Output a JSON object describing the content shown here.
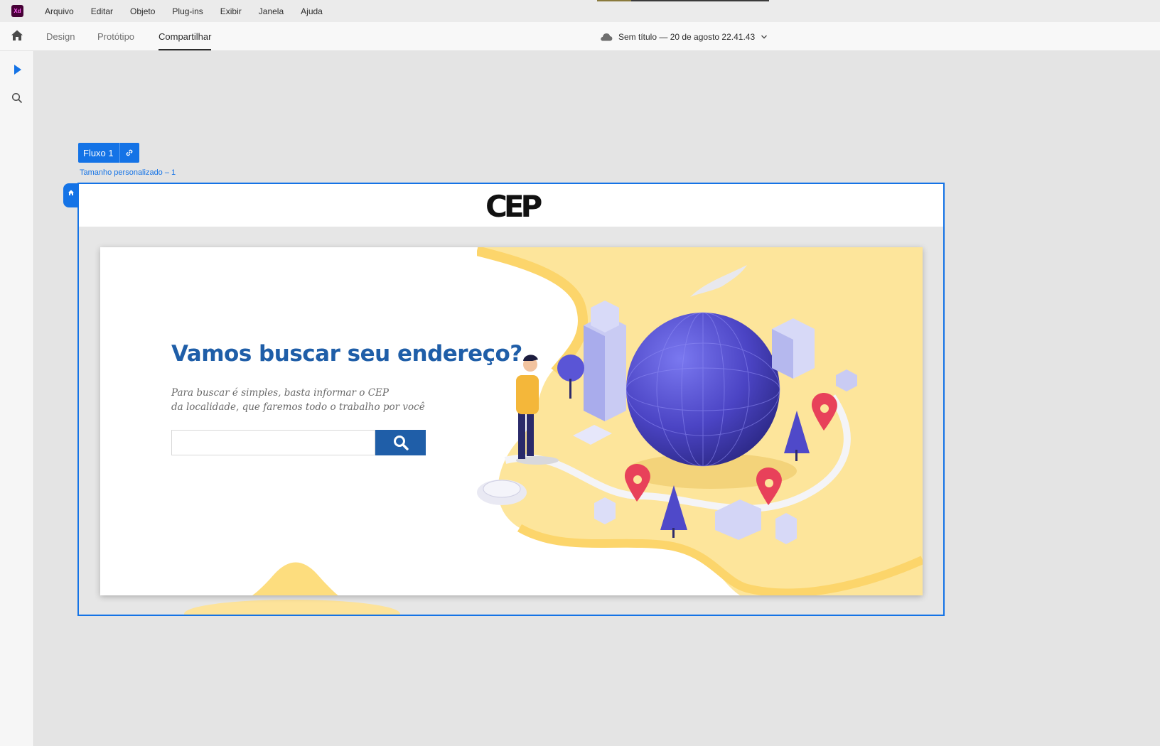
{
  "app": {
    "icon_text": "Xd"
  },
  "menu": [
    "Arquivo",
    "Editar",
    "Objeto",
    "Plug-ins",
    "Exibir",
    "Janela",
    "Ajuda"
  ],
  "tabs": {
    "design": "Design",
    "prototype": "Protótipo",
    "share": "Compartilhar"
  },
  "document": {
    "title": "Sem título — 20 de agosto 22.41.43"
  },
  "flow": {
    "label": "Fluxo 1"
  },
  "artboard": {
    "name": "Tamanho personalizado – 1"
  },
  "page": {
    "logo": "CEP",
    "headline": "Vamos buscar seu endereço?",
    "subtext_line1": "Para buscar é simples, basta informar o CEP",
    "subtext_line2": "da localidade, que faremos todo o trabalho por você",
    "search_value": ""
  },
  "colors": {
    "accent": "#1473e6",
    "brand_blue": "#1f5ea8",
    "yellow": "#fde39a",
    "globe": "#4f49c9",
    "pin": "#e8415a"
  }
}
